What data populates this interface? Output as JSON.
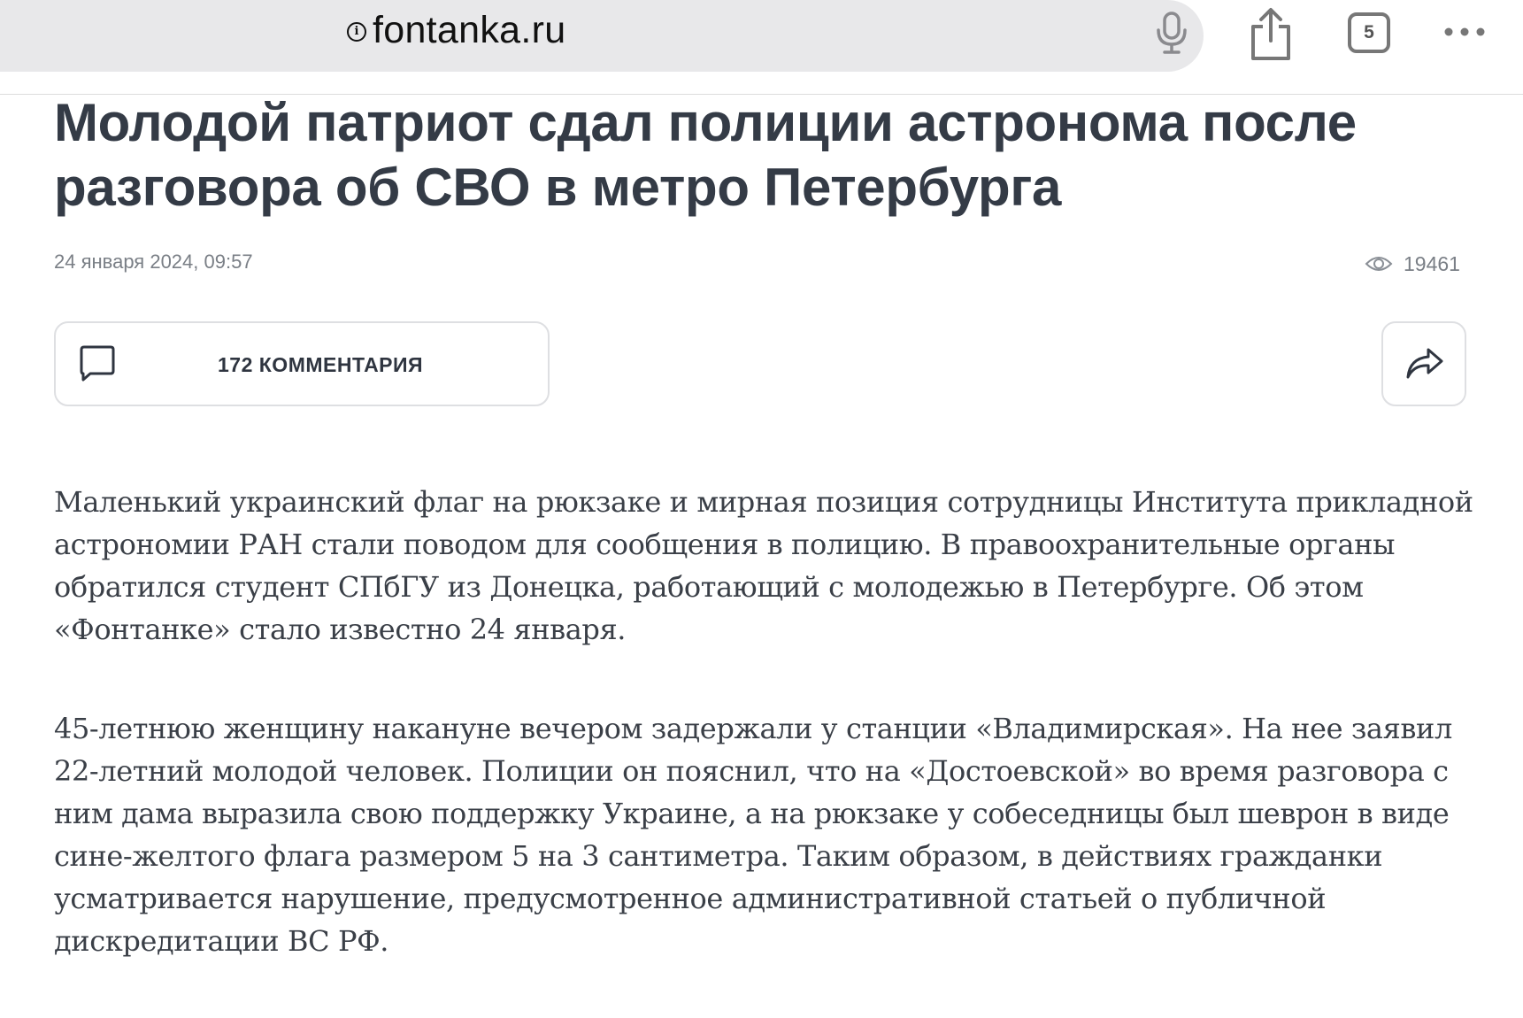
{
  "browser": {
    "url": "fontanka.ru",
    "site_info_symbol": "i",
    "tab_count": "5",
    "icons": [
      "site-info-icon",
      "microphone-icon",
      "share-icon",
      "tabs-icon",
      "more-icon"
    ]
  },
  "article": {
    "headline": "Молодой патриот сдал полиции астронома после разговора об СВО в метро Петербурга",
    "date": "24 января 2024, 09:57",
    "views": "19461",
    "comments_label": "172 КОММЕНТАРИЯ",
    "paragraphs": [
      "Маленький украинский флаг на рюкзаке и мирная позиция сотрудницы Института прикладной астрономии РАН стали поводом для сообщения в полицию. В правоохранительные органы обратился студент СПбГУ из Донецка, работающий с молодежью в Петербурге. Об этом «Фонтанке» стало известно 24 января.",
      "45-летнюю женщину накануне вечером задержали у станции «Владимирская». На нее заявил 22-летний молодой человек. Полиции он пояснил, что на «Достоевской» во время разговора с ним дама выразила свою поддержку Украине, а на рюкзаке у собеседницы был шеврон в виде сине-желтого флага размером 5 на 3 сантиметра. Таким образом, в действиях гражданки усматривается нарушение, предусмотренное административной статьей о публичной дискредитации ВС РФ."
    ]
  },
  "colors": {
    "headline": "#343b46",
    "meta_text": "#7a7f86",
    "body_text": "#3a3f47",
    "address_bar": "#e8e8ea",
    "button_border": "#dedfe2"
  }
}
